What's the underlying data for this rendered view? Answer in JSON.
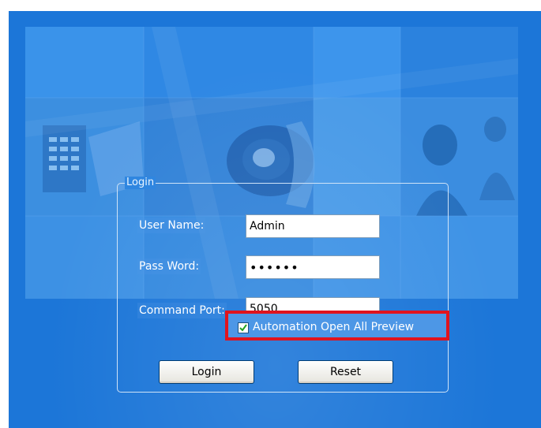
{
  "login": {
    "group_title": "Login",
    "username_label": "User Name:",
    "username_value": "Admin",
    "password_label": "Pass Word:",
    "password_value": "••••••",
    "port_label": "Command Port:",
    "port_value": "5050",
    "auto_preview_label": "Automation Open All Preview",
    "auto_preview_checked": true,
    "login_button": "Login",
    "reset_button": "Reset"
  },
  "colors": {
    "background": "#1c76d8",
    "highlight_border": "#e0141e",
    "checkmark": "#21a121"
  }
}
